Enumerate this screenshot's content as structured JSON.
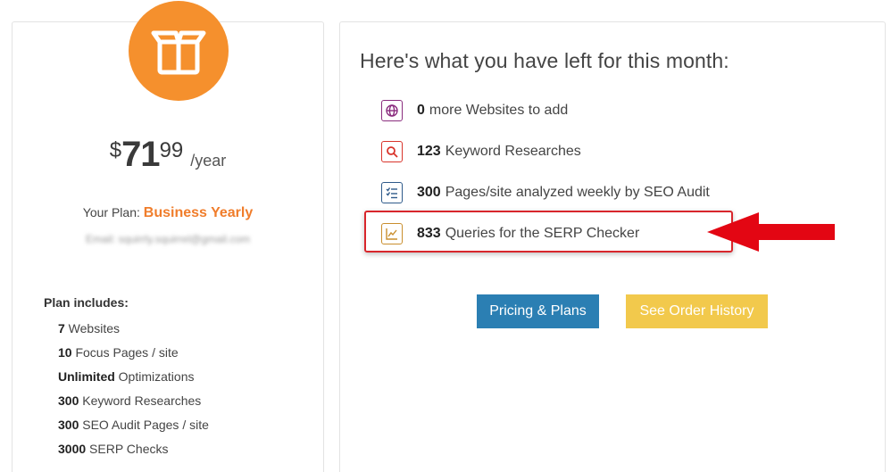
{
  "plan": {
    "badge_icon": "box-icon",
    "currency": "$",
    "price_whole": "71",
    "price_cents": "99",
    "period": "/year",
    "your_plan_label": "Your Plan:",
    "plan_name": "Business Yearly",
    "email": "Email: squirrly.squirrel@gmail.com",
    "includes_title": "Plan includes:",
    "includes": [
      {
        "bold": "7",
        "text": " Websites"
      },
      {
        "bold": "10",
        "text": " Focus Pages / site"
      },
      {
        "bold": "Unlimited",
        "text": " Optimizations"
      },
      {
        "bold": "300",
        "text": " Keyword Researches"
      },
      {
        "bold": "300",
        "text": " SEO Audit Pages / site"
      },
      {
        "bold": "3000",
        "text": " SERP Checks"
      }
    ]
  },
  "usage": {
    "title": "Here's what you have left for this month:",
    "rows": [
      {
        "icon": "globe-icon",
        "count": "0",
        "text": "more Websites to add"
      },
      {
        "icon": "search-icon",
        "count": "123",
        "text": "Keyword Researches"
      },
      {
        "icon": "checklist-icon",
        "count": "300",
        "text": "Pages/site analyzed weekly by SEO Audit"
      },
      {
        "icon": "chart-icon",
        "count": "833",
        "text": "Queries for the SERP Checker"
      }
    ],
    "pricing_button": "Pricing & Plans",
    "history_button": "See Order History"
  },
  "colors": {
    "orange": "#f5902d",
    "plan_name": "#f07d2b",
    "pricing_button": "#2b7fb3",
    "history_button": "#f2c94c",
    "highlight": "#d8262c",
    "arrow": "#e30613"
  }
}
